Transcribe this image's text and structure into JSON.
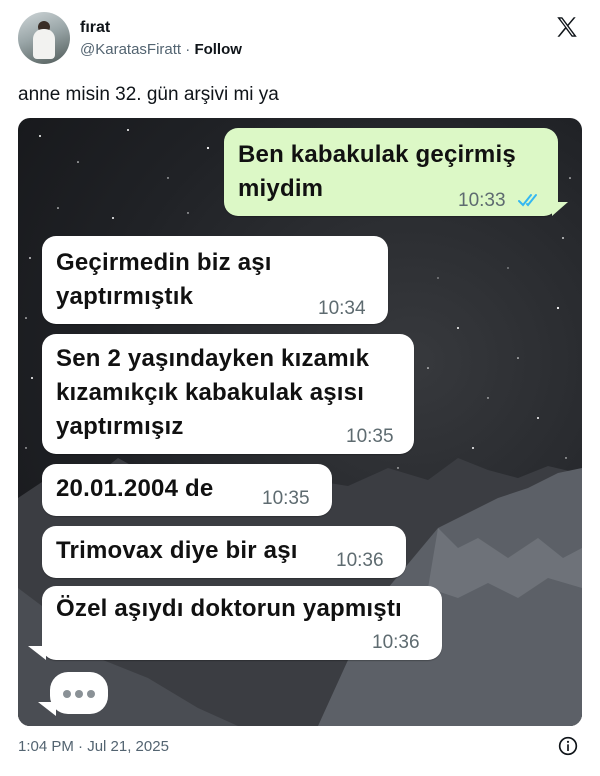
{
  "author": {
    "name": "fırat",
    "handle": "@KaratasFiratt",
    "separator": "·",
    "follow_label": "Follow"
  },
  "platform_icon": "x-logo-icon",
  "tweet": {
    "text": "anne misin 32. gün arşivi mi ya"
  },
  "chat": {
    "sent_color": "#dcf8c6",
    "received_color": "#ffffff",
    "read_receipt_color": "#34b7f1",
    "messages": [
      {
        "side": "sent",
        "lines": [
          "Ben kabakulak geçirmiş",
          "miydim"
        ],
        "time": "10:33",
        "status": "read"
      },
      {
        "side": "received",
        "lines": [
          "Geçirmedin biz aşı",
          "yaptırmıştık"
        ],
        "time": "10:34"
      },
      {
        "side": "received",
        "lines": [
          "Sen 2 yaşındayken kızamık",
          "kızamıkçık kabakulak aşısı",
          "yaptırmışız"
        ],
        "time": "10:35"
      },
      {
        "side": "received",
        "lines": [
          "20.01.2004 de"
        ],
        "time": "10:35"
      },
      {
        "side": "received",
        "lines": [
          "Trimovax diye bir aşı"
        ],
        "time": "10:36"
      },
      {
        "side": "received",
        "lines": [
          "Özel aşıydı doktorun yapmıştı"
        ],
        "time": "10:36"
      }
    ],
    "typing_indicator": "typing-dots-icon"
  },
  "footer": {
    "timestamp": "1:04 PM · Jul 21, 2025",
    "info_icon": "info-icon"
  }
}
